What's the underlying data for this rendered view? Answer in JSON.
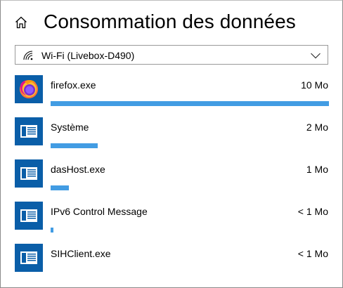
{
  "header": {
    "title": "Consommation des données",
    "home_icon": "home-icon"
  },
  "network": {
    "label": "Wi-Fi (Livebox-D490)",
    "icon": "wifi-icon"
  },
  "apps": [
    {
      "name": "firefox.exe",
      "usage": "10 Mo",
      "fraction": 1.0,
      "icon": "firefox-icon"
    },
    {
      "name": "Système",
      "usage": "2 Mo",
      "fraction": 0.17,
      "icon": "app-window-icon"
    },
    {
      "name": "dasHost.exe",
      "usage": "1 Mo",
      "fraction": 0.065,
      "icon": "app-window-icon"
    },
    {
      "name": "IPv6 Control Message",
      "usage": "< 1 Mo",
      "fraction": 0.01,
      "icon": "app-window-icon"
    },
    {
      "name": "SIHClient.exe",
      "usage": "< 1 Mo",
      "fraction": 0.0,
      "icon": "app-window-icon"
    }
  ],
  "colors": {
    "bar": "#429ce3",
    "app_icon_bg": "#0a5ea8",
    "accent": "#0078d7"
  }
}
